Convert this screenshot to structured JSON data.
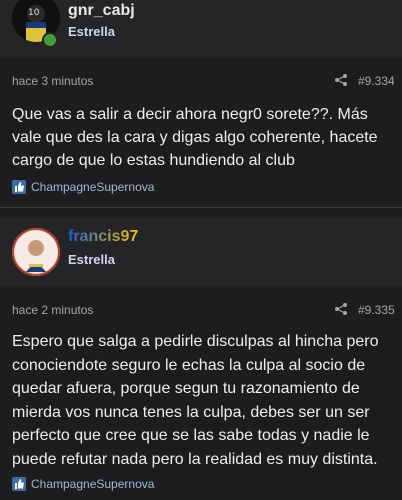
{
  "posts": [
    {
      "username": "gnr_cabj",
      "rank": "Estrella",
      "time": "hace 3 minutos",
      "number": "#9.334",
      "body": "Que vas a salir a decir ahora negr0 sorete??. Más vale que des la cara y digas algo coherente, hacete cargo de que lo estas hundiendo al club",
      "reaction": "ChampagneSupernova"
    },
    {
      "username": "francis97",
      "rank": "Estrella",
      "time": "hace 2 minutos",
      "number": "#9.335",
      "body": "Espero que salga a pedirle disculpas al hincha pero conociendote seguro le echas la culpa al socio de quedar afuera, porque segun tu razonamiento de mierda vos nunca tenes la culpa, debes ser un ser perfecto que cree que se las sabe todas y nadie le puede refutar nada pero la realidad es muy distinta.",
      "reaction": "ChampagneSupernova"
    }
  ],
  "colors": {
    "background": "#1d1d1f",
    "header": "#252527",
    "username_gradient_start": "#1e5bd8",
    "username_gradient_end": "#f2c200",
    "online": "#3f9e3a"
  }
}
